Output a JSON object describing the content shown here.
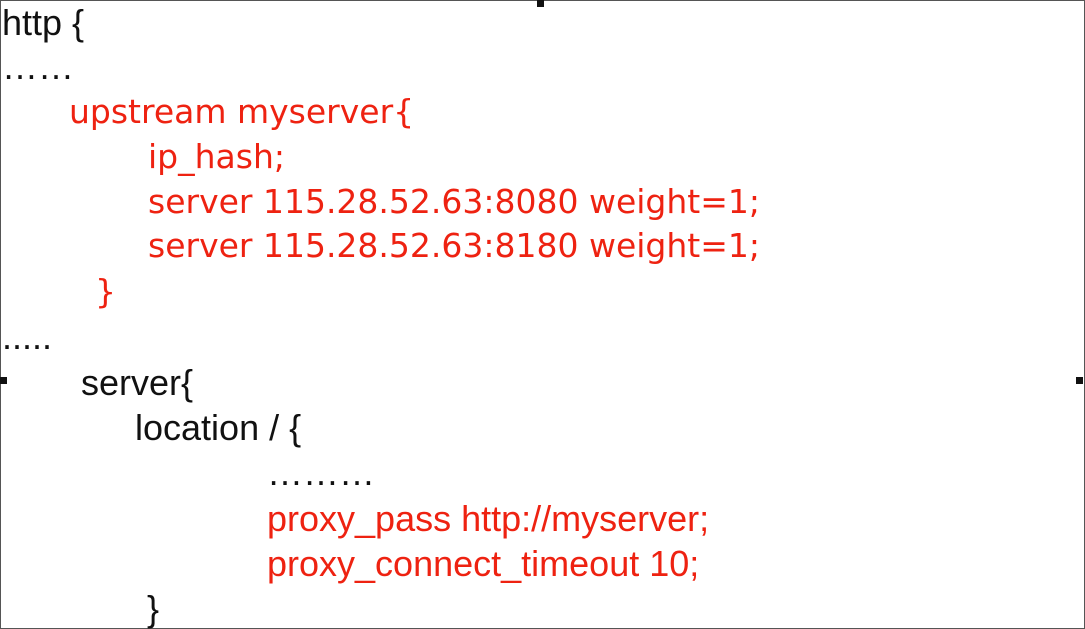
{
  "colors": {
    "black": "#111111",
    "red": "#ee2211"
  },
  "code": {
    "http_open": "http {",
    "dots_1": "……",
    "upstream_open": "upstream myserver{",
    "ip_hash": "ip_hash;",
    "server_1": "server 115.28.52.63:8080 weight=1;",
    "server_2": "server 115.28.52.63:8180 weight=1;",
    "upstream_close": "}",
    "dots_2": ".....",
    "server_open": "server{",
    "location_open": "location / {",
    "dots_3": "………",
    "proxy_pass": "proxy_pass http://myserver;",
    "proxy_connect_timeout": "proxy_connect_timeout 10;",
    "location_close": "}"
  }
}
